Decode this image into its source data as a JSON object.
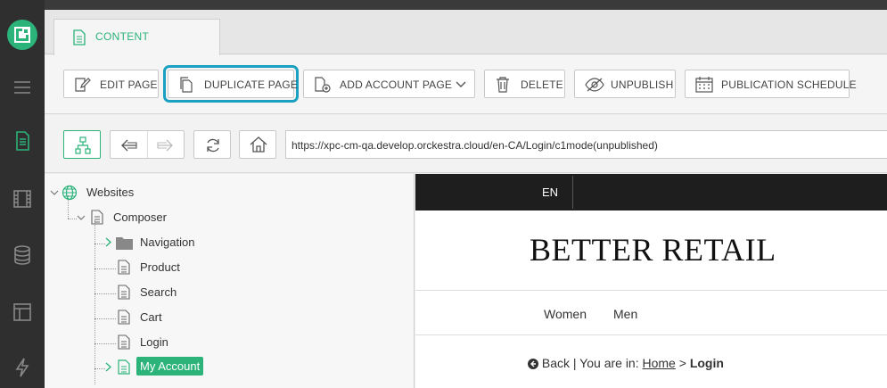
{
  "content_tab": {
    "label": "CONTENT"
  },
  "toolbar": {
    "edit_page": "EDIT PAGE",
    "duplicate_page": "DUPLICATE PAGE",
    "add_account_page": "ADD ACCOUNT PAGE",
    "delete": "DELETE",
    "unpublish": "UNPUBLISH",
    "publication_schedule": "PUBLICATION SCHEDULE"
  },
  "address_bar": {
    "url": "https://xpc-cm-qa.develop.orckestra.cloud/en-CA/Login/c1mode(unpublished)"
  },
  "tree": {
    "root": "Websites",
    "site": "Composer",
    "items": [
      "Navigation",
      "Product",
      "Search",
      "Cart",
      "Login",
      "My Account"
    ]
  },
  "preview": {
    "language": "EN",
    "brand": "BETTER RETAIL",
    "menu": [
      "Women",
      "Men"
    ],
    "breadcrumb": {
      "back": "Back",
      "you_are_in": "| You are in:",
      "home": "Home",
      "separator": ">",
      "current": "Login"
    }
  },
  "colors": {
    "accent": "#2bb37a",
    "highlight": "#1aa0c0",
    "rail": "#2f2f2f"
  }
}
